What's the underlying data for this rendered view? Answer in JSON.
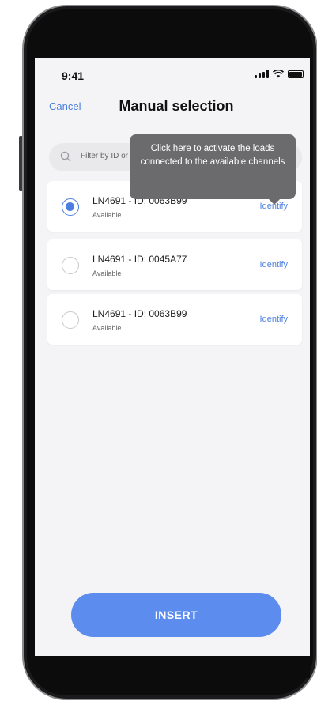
{
  "status_bar": {
    "time": "9:41"
  },
  "header": {
    "cancel_label": "Cancel",
    "title": "Manual selection"
  },
  "search": {
    "placeholder": "Filter by ID or ..."
  },
  "tooltip": {
    "text": "Click here to activate the loads connected to the available channels"
  },
  "devices": [
    {
      "name": "LN4691 - ID: 0063B99",
      "status": "Available",
      "action": "Identify",
      "selected": true
    },
    {
      "name": "LN4691 - ID: 0045A77",
      "status": "Available",
      "action": "Identify",
      "selected": false
    },
    {
      "name": "LN4691 - ID: 0063B99",
      "status": "Available",
      "action": "Identify",
      "selected": false
    }
  ],
  "footer": {
    "insert_label": "INSERT"
  },
  "colors": {
    "accent": "#4a7ee0",
    "button": "#5b8cee",
    "tooltip": "#6b6b6e"
  }
}
